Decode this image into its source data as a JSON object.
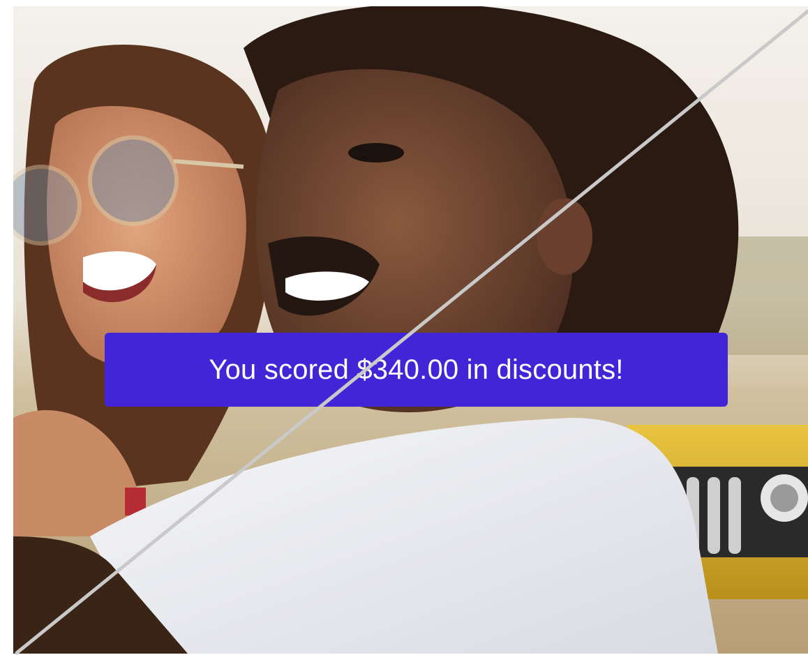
{
  "banner": {
    "text": "You scored $340.00 in discounts!",
    "background_color": "#4125d6",
    "text_color": "#ffffff"
  },
  "colors": {
    "slash_line": "#c9c9c9"
  }
}
